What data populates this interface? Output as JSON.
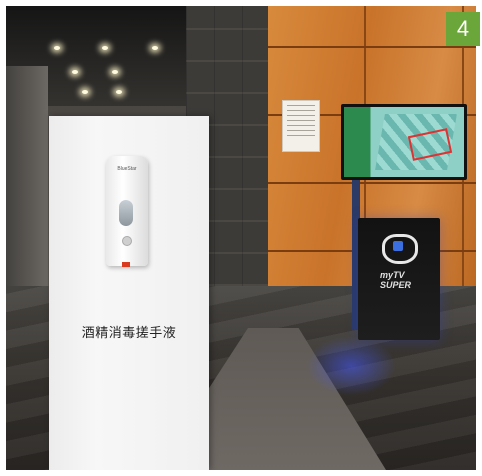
{
  "badge": {
    "number": "4",
    "color": "#6ba63a"
  },
  "sign": {
    "label": "酒精消毒搓手液"
  },
  "dispenser": {
    "brand": "BlueStar"
  },
  "kiosk": {
    "logo_text": "myTV SUPER"
  }
}
